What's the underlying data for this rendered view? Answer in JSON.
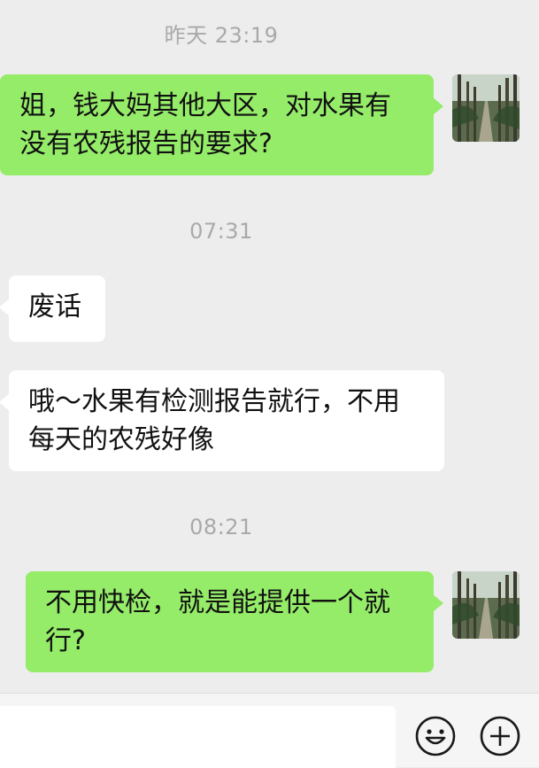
{
  "chat": {
    "messages": [
      {
        "type": "timestamp",
        "text": "昨天 23:19"
      },
      {
        "type": "sent",
        "text": "姐，钱大妈其他大区，对水果有没有农残报告的要求?"
      },
      {
        "type": "timestamp",
        "text": "07:31"
      },
      {
        "type": "received",
        "text": "废话"
      },
      {
        "type": "received",
        "text": "哦～水果有检测报告就行，不用每天的农残好像"
      },
      {
        "type": "timestamp",
        "text": "08:21"
      },
      {
        "type": "sent",
        "text": "不用快检，就是能提供一个就行?"
      }
    ]
  },
  "lines": {
    "m1": [
      "姐，钱大妈其他大区，对水果有",
      "没有农残报告的要求?"
    ],
    "m4": [
      "哦～水果有检测报告就行，不用",
      "每天的农残好像"
    ],
    "m5": [
      "不用快检，就是能提供一个就",
      "行?"
    ]
  },
  "input_bar": {
    "input_value": "",
    "emoji_icon": "emoji-icon",
    "add_icon": "plus-circle-icon"
  },
  "colors": {
    "chat_background": "#ededed",
    "sent_bubble": "#95ec69",
    "received_bubble": "#ffffff",
    "timestamp_text": "#a9a9a9"
  }
}
